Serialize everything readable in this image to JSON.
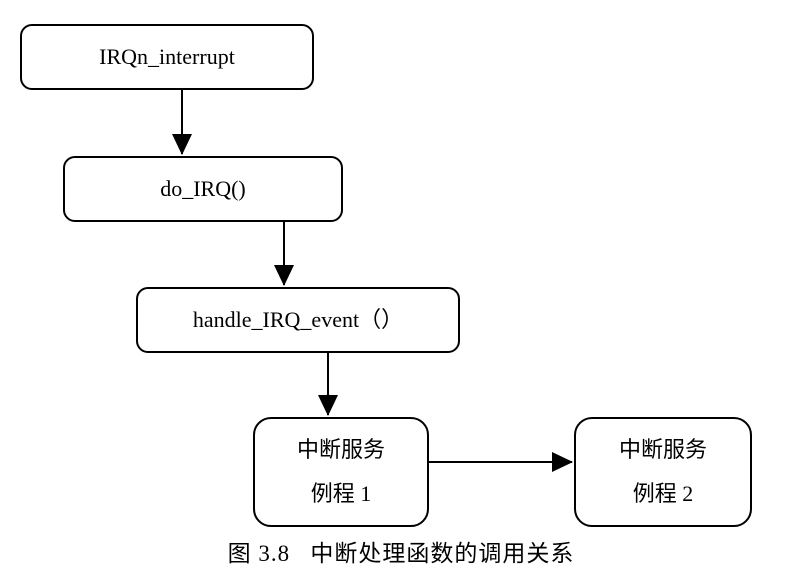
{
  "diagram": {
    "nodes": {
      "irqn_interrupt": "IRQn_interrupt",
      "do_irq": "do_IRQ()",
      "handle_irq_event": "handle_IRQ_event（）",
      "routine1": {
        "line1": "中断服务",
        "line2": "例程 1"
      },
      "routine2": {
        "line1": "中断服务",
        "line2": "例程 2"
      }
    },
    "edges": [
      {
        "from": "irqn_interrupt",
        "to": "do_irq"
      },
      {
        "from": "do_irq",
        "to": "handle_irq_event"
      },
      {
        "from": "handle_irq_event",
        "to": "routine1"
      },
      {
        "from": "routine1",
        "to": "routine2"
      }
    ],
    "caption": "图 3.8   中断处理函数的调用关系"
  }
}
